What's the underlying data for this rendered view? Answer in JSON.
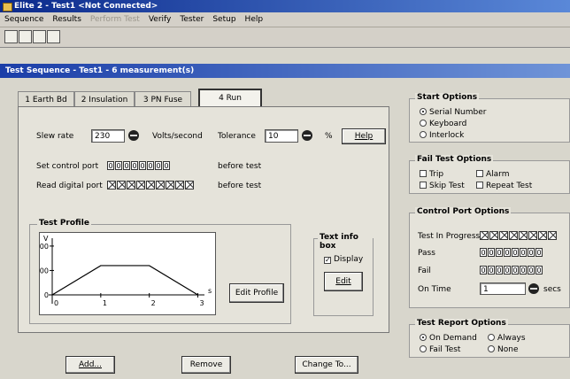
{
  "window_title": "Elite 2 - Test1   <Not Connected>",
  "menu": [
    "Sequence",
    "Results",
    "Perform Test",
    "Verify",
    "Tester",
    "Setup",
    "Help"
  ],
  "toolbar_icons": [
    "new-file-icon",
    "open-folder-icon",
    "save-icon",
    "print-preview-icon"
  ],
  "subwindow_title": "Test Sequence - Test1 - 6 measurement(s)",
  "tabs": [
    "1  Earth Bd",
    "2  Insulation",
    "3  PN Fuse",
    "4  Run"
  ],
  "run": {
    "slew_label": "Slew rate",
    "slew_value": "230",
    "slew_unit": "Volts/second",
    "tol_label": "Tolerance",
    "tol_value": "10",
    "tol_unit": "%",
    "help": "Help",
    "set_port_label": "Set control port",
    "set_port_bits": [
      "0",
      "0",
      "0",
      "0",
      "0",
      "0",
      "0",
      "0"
    ],
    "set_port_suffix": "before test",
    "read_port_label": "Read digital port",
    "read_port_suffix": "before test"
  },
  "profile": {
    "title": "Test Profile",
    "edit": "Edit Profile",
    "y_label": "V",
    "x_label": "s",
    "y_ticks": [
      "400",
      "200",
      "0"
    ],
    "x_ticks": [
      "0",
      "1",
      "2",
      "3"
    ],
    "points": [
      [
        0,
        0
      ],
      [
        1,
        240
      ],
      [
        2,
        240
      ],
      [
        3,
        0
      ]
    ],
    "ylim": [
      0,
      450
    ],
    "xlim": [
      0,
      3.1
    ]
  },
  "text_info": {
    "title": "Text info box",
    "display": "Display",
    "edit": "Edit"
  },
  "bottom_buttons": [
    "Add...",
    "Remove",
    "Change To..."
  ],
  "start_options": {
    "title": "Start Options",
    "items": [
      "Serial Number",
      "Keyboard",
      "Interlock"
    ],
    "selected": 0
  },
  "fail_options": {
    "title": "Fail Test Options",
    "items": [
      "Trip",
      "Alarm",
      "Skip Test",
      "Repeat Test"
    ]
  },
  "control_port": {
    "title": "Control Port Options",
    "test_in_progress": "Test In Progress",
    "pass": "Pass",
    "fail": "Fail",
    "on_time": "On Time",
    "on_time_value": "1",
    "secs": "secs",
    "bits": [
      "0",
      "0",
      "0",
      "0",
      "0",
      "0",
      "0",
      "0"
    ]
  },
  "report_options": {
    "title": "Test Report Options",
    "items": [
      "On Demand",
      "Always",
      "Fail Test",
      "None"
    ],
    "selected": 0
  }
}
